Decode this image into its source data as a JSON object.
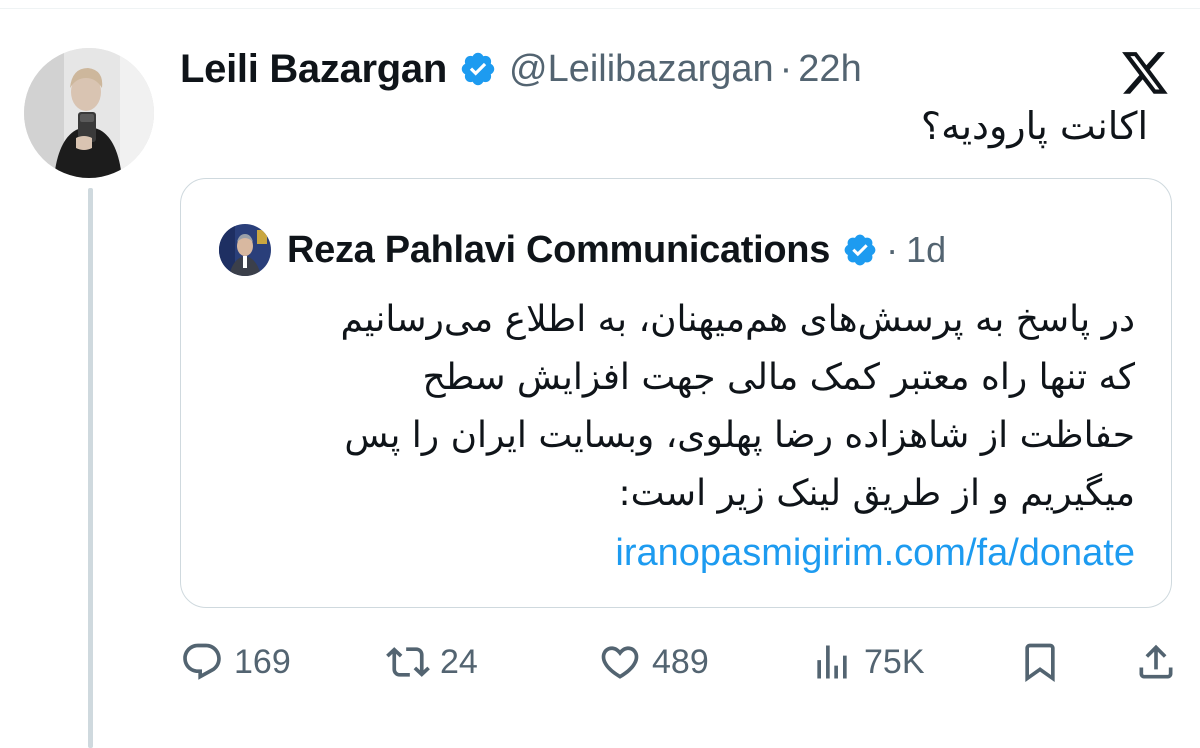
{
  "tweet": {
    "author": {
      "display_name": "Leili Bazargan",
      "handle": "@Leilibazargan",
      "verified": true,
      "avatar_icon": "profile-photo"
    },
    "separator": "·",
    "time": "22h",
    "platform_icon": "x-logo-icon",
    "text": "اکانت پارودیه؟",
    "quoted": {
      "author": {
        "display_name": "Reza Pahlavi Communications",
        "verified": true,
        "avatar_icon": "profile-photo"
      },
      "separator": "·",
      "time": "1d",
      "lines": [
        "در پاسخ به پرسش‌های هم‌میهنان، به اطلاع می‌رسانیم",
        "که تنها راه معتبر کمک مالی جهت افزایش سطح",
        "حفاظت از شاهزاده رضا پهلوی، وبسایت ایران را پس",
        "میگیریم و از طریق لینک زیر است:"
      ],
      "link": "iranopasmigirim.com/fa/donate"
    },
    "actions": {
      "replies": "169",
      "retweets": "24",
      "likes": "489",
      "views": "75K"
    }
  },
  "colors": {
    "accent": "#1d9bf0",
    "text": "#0f1419",
    "muted": "#536471",
    "border": "#cfd9de"
  }
}
